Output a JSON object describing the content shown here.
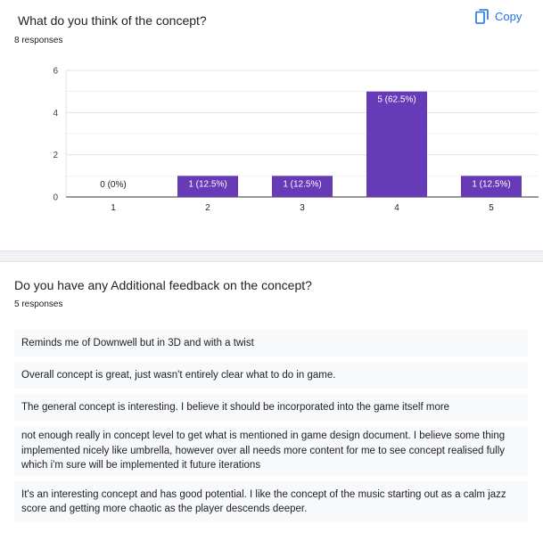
{
  "question1": {
    "title": "What do you think of the concept?",
    "responses": "8 responses",
    "copy_label": "Copy",
    "copy_icon": "copy-icon"
  },
  "chart_data": {
    "type": "bar",
    "categories": [
      "1",
      "2",
      "3",
      "4",
      "5"
    ],
    "values": [
      0,
      1,
      1,
      5,
      1
    ],
    "data_labels": [
      "0 (0%)",
      "1 (12.5%)",
      "1 (12.5%)",
      "5 (62.5%)",
      "1 (12.5%)"
    ],
    "yticks": [
      0,
      2,
      4,
      6
    ],
    "ylim": [
      0,
      6
    ],
    "title": "",
    "xlabel": "",
    "ylabel": "",
    "grid": true,
    "bar_color": "#673ab7"
  },
  "question2": {
    "title": "Do you have any Additional feedback on the concept?",
    "responses": "5 responses",
    "answers": [
      "Reminds me of Downwell but in 3D and with a twist",
      "Overall concept is great, just wasn't entirely clear what to do in game.",
      "The general concept is interesting. I believe it should be incorporated into the game itself more",
      "not enough really in concept level to get what is mentioned in game design document. I believe some thing implemented nicely like umbrella, however over all needs more content for me to see concept realised fully which i'm sure will be implemented it future iterations",
      "It's an interesting concept and has good potential. I like the concept of the music starting out as a calm jazz score and getting more chaotic as the player descends deeper."
    ]
  }
}
